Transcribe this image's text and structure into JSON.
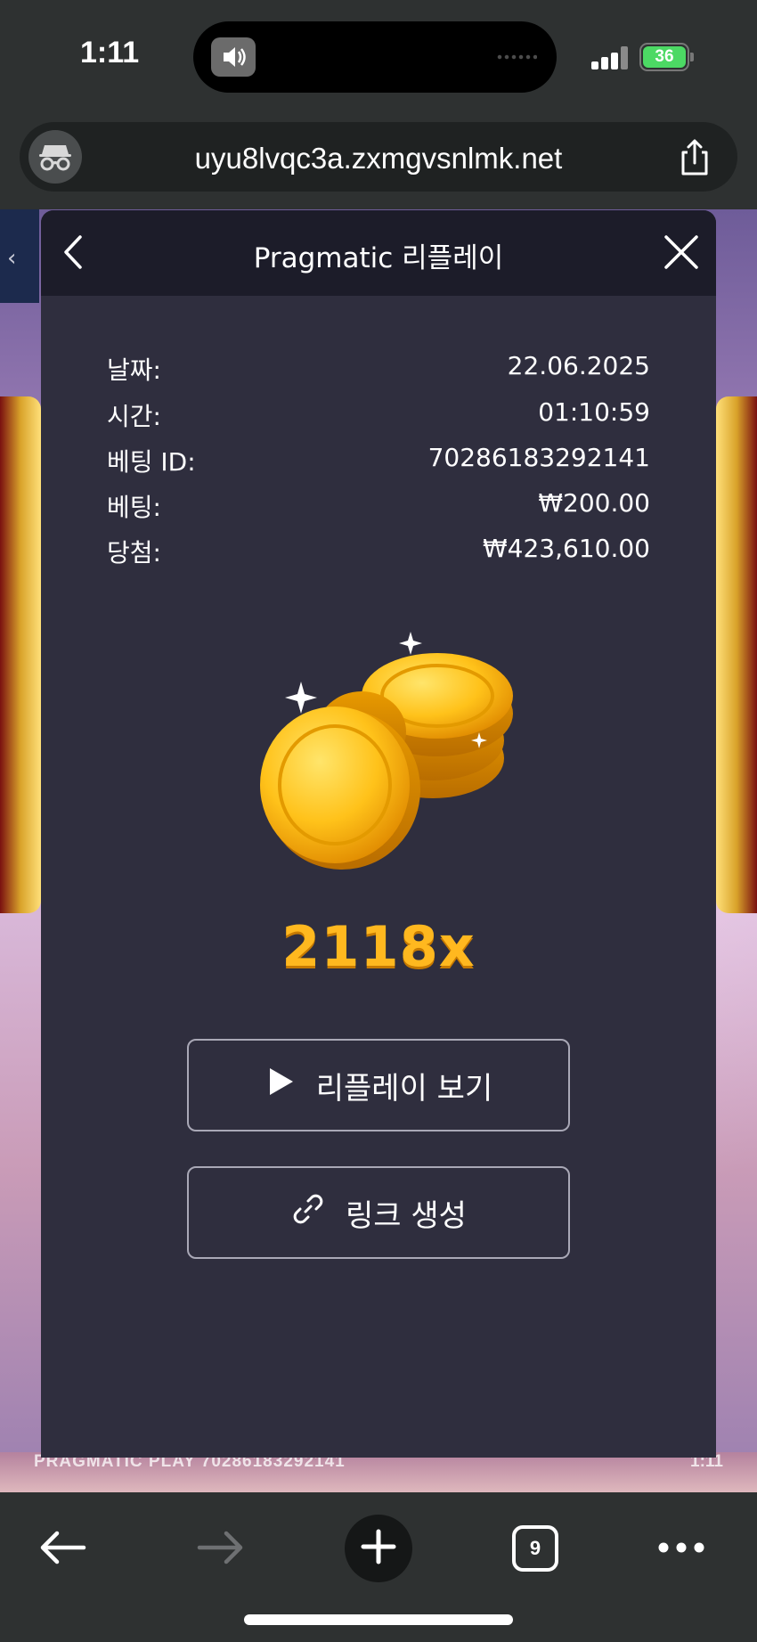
{
  "status_bar": {
    "time": "1:11",
    "battery": "36"
  },
  "browser": {
    "url": "uyu8lvqc3a.zxmgvsnlmk.net",
    "tab_count": "9"
  },
  "game": {
    "footer_text": "PRAGMATIC PLAY  70286183292141",
    "footer_time": "1:11"
  },
  "modal": {
    "title": "Pragmatic 리플레이",
    "info": [
      {
        "label": "날짜:",
        "value": "22.06.2025"
      },
      {
        "label": "시간:",
        "value": "01:10:59"
      },
      {
        "label": "베팅 ID:",
        "value": "70286183292141"
      },
      {
        "label": "베팅:",
        "value": "₩200.00"
      },
      {
        "label": "당첨:",
        "value": "₩423,610.00"
      }
    ],
    "multiplier": "2118x",
    "watch_replay_label": "리플레이 보기",
    "create_link_label": "링크 생성"
  },
  "colors": {
    "modal_bg": "#2f2e3e",
    "modal_header_bg": "#1c1c29",
    "multiplier": "#ffb81f",
    "battery": "#4cd964"
  },
  "icons": [
    "incognito-icon",
    "share-icon",
    "back-chevron-icon",
    "close-icon",
    "coins-icon",
    "play-icon",
    "link-icon",
    "back-arrow-icon",
    "forward-arrow-icon",
    "plus-icon",
    "more-icon"
  ]
}
